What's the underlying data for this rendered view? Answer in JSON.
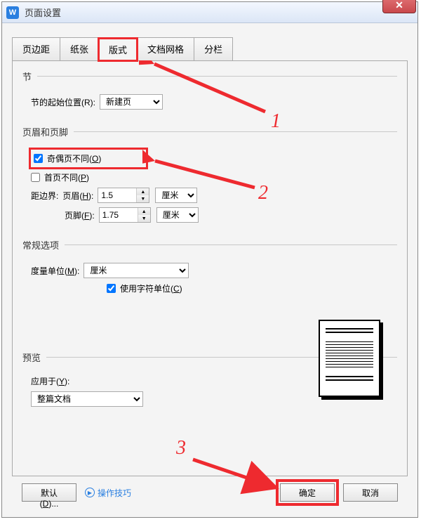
{
  "window": {
    "title": "页面设置",
    "icon_letter": "W"
  },
  "tabs": {
    "margin": "页边距",
    "paper": "纸张",
    "layout": "版式",
    "grid": "文档网格",
    "columns": "分栏"
  },
  "section": {
    "legend": "节",
    "start_label": "节的起始位置(R):",
    "start_value": "新建页"
  },
  "header_footer": {
    "legend": "页眉和页脚",
    "odd_even_label": "奇偶页不同(O)",
    "first_page_label": "首页不同(P)",
    "boundary_label": "距边界:",
    "header_label": "页眉(H):",
    "header_value": "1.5",
    "footer_label": "页脚(F):",
    "footer_value": "1.75",
    "unit": "厘米"
  },
  "general": {
    "legend": "常规选项",
    "measure_label": "度量单位(M):",
    "measure_value": "厘米",
    "char_unit_label": "使用字符单位(C)"
  },
  "preview": {
    "legend": "预览",
    "apply_label": "应用于(Y):",
    "apply_value": "整篇文档"
  },
  "buttons": {
    "default": "默认(D)...",
    "tips": "操作技巧",
    "ok": "确定",
    "cancel": "取消"
  },
  "annotations": {
    "n1": "1",
    "n2": "2",
    "n3": "3"
  }
}
